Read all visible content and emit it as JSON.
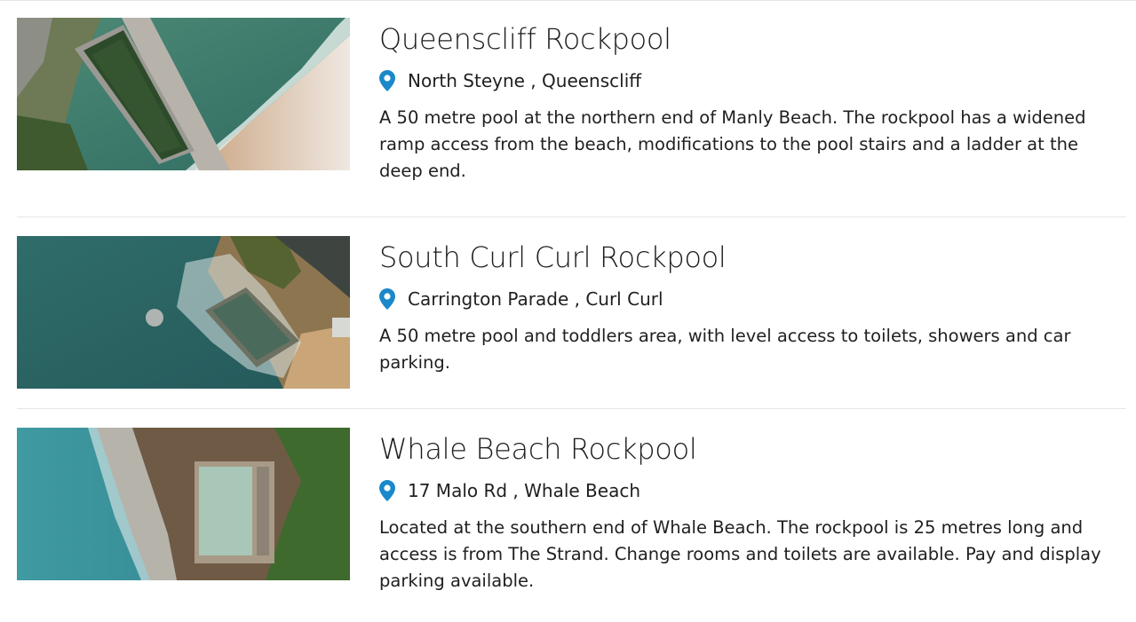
{
  "pools": [
    {
      "title": "Queenscliff Rockpool",
      "location": "North Steyne , Queenscliff",
      "description": "A 50 metre pool at the northern end of Manly Beach. The rockpool has a widened ramp access from the beach, modifications to the pool stairs and a ladder at the deep end.",
      "image_name": "aerial-photo-queenscliff-rockpool"
    },
    {
      "title": "South Curl Curl Rockpool",
      "location": "Carrington Parade , Curl Curl",
      "description": "A 50 metre pool and toddlers area, with level access to toilets, showers and car parking.",
      "image_name": "aerial-photo-south-curl-curl-rockpool"
    },
    {
      "title": "Whale Beach Rockpool",
      "location": "17 Malo Rd , Whale Beach",
      "description": "Located at the southern end of Whale Beach. The rockpool is 25 metres long and access is from The Strand. Change rooms and toilets are available. Pay and display parking available.",
      "image_name": "aerial-photo-whale-beach-rockpool"
    }
  ],
  "colors": {
    "pin": "#1a88c9",
    "divider": "#e6e6e6",
    "text": "#1f1f1f"
  },
  "icons": {
    "location": "map-pin-icon"
  }
}
